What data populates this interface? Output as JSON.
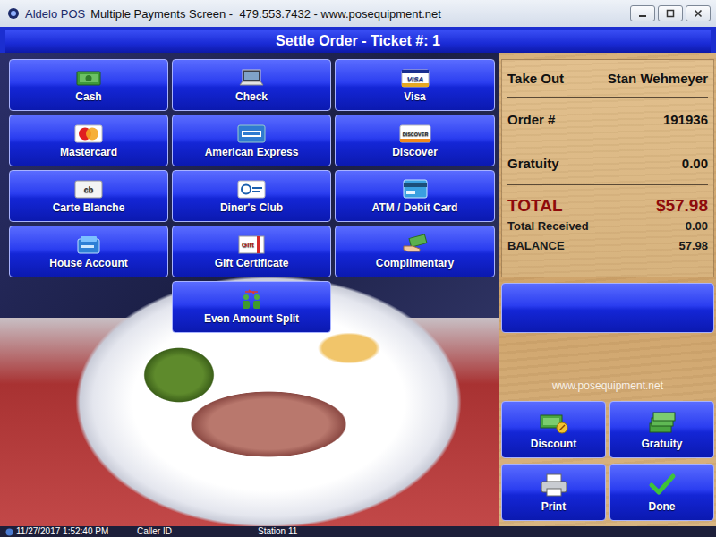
{
  "window": {
    "app": "Aldelo POS",
    "title": "Multiple Payments Screen -  479.553.7432 - www.posequipment.net"
  },
  "header": "Settle Order - Ticket #: 1",
  "payment_methods": [
    {
      "label": "Cash"
    },
    {
      "label": "Check"
    },
    {
      "label": "Visa",
      "logo": "VISA"
    },
    {
      "label": "Mastercard"
    },
    {
      "label": "American Express"
    },
    {
      "label": "Discover",
      "logo": "DISCOVER"
    },
    {
      "label": "Carte Blanche",
      "logo": "cb"
    },
    {
      "label": "Diner's Club"
    },
    {
      "label": "ATM / Debit Card"
    },
    {
      "label": "House Account"
    },
    {
      "label": "Gift Certificate",
      "logo": "Gift"
    },
    {
      "label": "Complimentary"
    }
  ],
  "split_button": "Even Amount Split",
  "order": {
    "type": "Take Out",
    "customer": "Stan Wehmeyer",
    "rows": [
      {
        "label": "Order #",
        "value": "191936"
      },
      {
        "label": "Gratuity",
        "value": "0.00"
      }
    ],
    "total": {
      "label": "TOTAL",
      "value": "$57.98"
    },
    "received": {
      "label": "Total Received",
      "value": "0.00"
    },
    "balance": {
      "label": "BALANCE",
      "value": "57.98"
    }
  },
  "watermark": "www.posequipment.net",
  "actions": [
    "Discount",
    "Gratuity",
    "Print",
    "Done"
  ],
  "status_bar": [
    "11/27/2017 1:52:40 PM",
    "Caller ID",
    "Station 11"
  ]
}
